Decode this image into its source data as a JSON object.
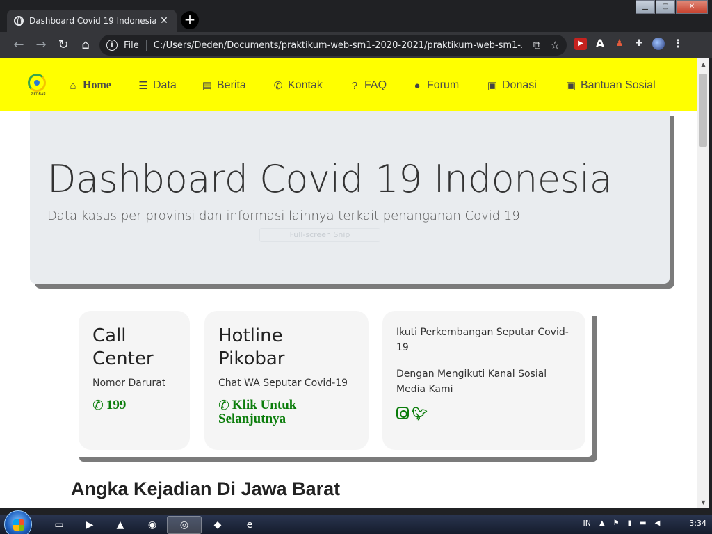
{
  "browser": {
    "tab_title": "Dashboard Covid 19 Indonesia",
    "scheme_label": "File",
    "url": "C:/Users/Deden/Documents/praktikum-web-sm1-2020-2021/praktikum-web-sm1-..."
  },
  "navbar": {
    "items": [
      {
        "label": "Home",
        "icon": "home-icon"
      },
      {
        "label": "Data",
        "icon": "database-icon"
      },
      {
        "label": "Berita",
        "icon": "newspaper-icon"
      },
      {
        "label": "Kontak",
        "icon": "phone-icon"
      },
      {
        "label": "FAQ",
        "icon": "question-circle-icon"
      },
      {
        "label": "Forum",
        "icon": "comment-icon"
      },
      {
        "label": "Donasi",
        "icon": "box-open-icon"
      },
      {
        "label": "Bantuan Sosial",
        "icon": "box-open-icon"
      }
    ],
    "background": "#ffff00"
  },
  "jumbotron": {
    "title": "Dashboard Covid 19 Indonesia",
    "subtitle": "Data kasus per provinsi dan informasi lainnya terkait penanganan Covid 19",
    "overlay": "Full-screen Snip"
  },
  "cards": {
    "call_center": {
      "title_line1": "Call",
      "title_line2": "Center",
      "text": "Nomor Darurat",
      "link": "199"
    },
    "hotline": {
      "title_line1": "Hotline",
      "title_line2": "Pikobar",
      "text": "Chat WA Seputar Covid-19",
      "link_line1": "Klik Untuk",
      "link_line2": "Selanjutnya"
    },
    "social": {
      "text1": "Ikuti Perkembangan Seputar Covid-19",
      "text2": "Dengan Mengikuti Kanal Sosial Media Kami"
    },
    "link_color": "#0b7d0b"
  },
  "section": {
    "title": "Angka Kejadian Di Jawa Barat"
  },
  "taskbar": {
    "language": "IN",
    "time": "3:34"
  }
}
